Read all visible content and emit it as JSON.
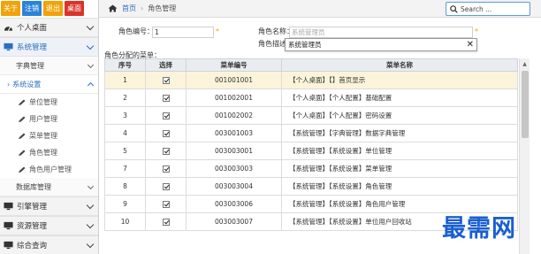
{
  "top_buttons": [
    "关于",
    "注销",
    "退出",
    "桌面"
  ],
  "sidebar": {
    "sections": [
      {
        "label": "个人桌面",
        "icon": "dashboard-icon"
      },
      {
        "label": "系统管理",
        "icon": "monitor-icon"
      }
    ],
    "sub": [
      {
        "label": "字典管理"
      },
      {
        "label": "系统设置"
      }
    ],
    "leaves": [
      "单位管理",
      "用户管理",
      "菜单管理",
      "角色管理",
      "角色用户管理"
    ],
    "after": {
      "label": "数据库管理"
    },
    "bottom_sections": [
      {
        "label": "引擎管理",
        "icon": "monitor-icon"
      },
      {
        "label": "资源管理",
        "icon": "monitor-icon"
      },
      {
        "label": "综合查询",
        "icon": "monitor-icon"
      }
    ]
  },
  "breadcrumb": {
    "home": "首页",
    "current": "角色管理"
  },
  "search": {
    "placeholder": "Search ..."
  },
  "form": {
    "role_no_label": "角色编号：",
    "role_no_value": "1",
    "role_name_label": "角色名称：",
    "role_name_placeholder": "系统管理员",
    "role_desc_label": "角色描述",
    "role_desc_dropdown": "系统管理员",
    "required_mark": "*"
  },
  "table_title": "角色分配的菜单：",
  "columns": [
    "序号",
    "选择",
    "菜单编号",
    "菜单名称"
  ],
  "rows": [
    {
      "no": "1",
      "code": "001001001",
      "name": "【个人桌面】【】首页显示",
      "checked": true
    },
    {
      "no": "2",
      "code": "001002001",
      "name": "【个人桌面】【个人配置】基础配置",
      "checked": true
    },
    {
      "no": "3",
      "code": "001002002",
      "name": "【个人桌面】【个人配置】密码设置",
      "checked": true
    },
    {
      "no": "4",
      "code": "003001003",
      "name": "【系统管理】【字典管理】数据字典管理",
      "checked": true
    },
    {
      "no": "5",
      "code": "003003001",
      "name": "【系统管理】【系统设置】单位管理",
      "checked": true
    },
    {
      "no": "7",
      "code": "003003003",
      "name": "【系统管理】【系统设置】菜单管理",
      "checked": true
    },
    {
      "no": "8",
      "code": "003003004",
      "name": "【系统管理】【系统设置】角色管理",
      "checked": true
    },
    {
      "no": "9",
      "code": "003003006",
      "name": "【系统管理】【系统设置】角色用户管理",
      "checked": true
    },
    {
      "no": "10",
      "code": "003003007",
      "name": "【系统管理】【系统设置】单位用户回收站",
      "checked": true
    }
  ],
  "watermark": "最需网",
  "colors": {
    "accent": "#2b6fc0",
    "highlight_row": "#fbf4da",
    "required": "#f0a30a"
  }
}
